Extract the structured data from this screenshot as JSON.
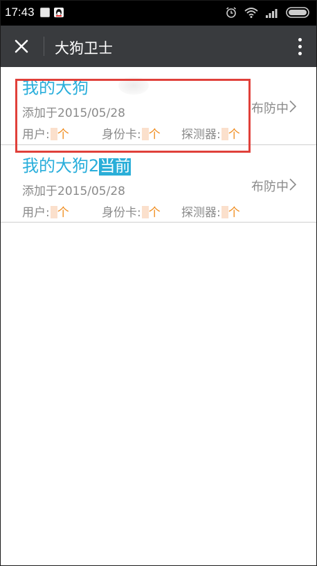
{
  "status_bar": {
    "time": "17:43"
  },
  "app_bar": {
    "title": "大狗卫士"
  },
  "devices": [
    {
      "name": "我的大狗",
      "badge": "",
      "added": "添加于2015/05/28",
      "status": "布防中",
      "stats": {
        "users_label": "用户:",
        "idcards_label": "身份卡:",
        "detectors_label": "探测器:",
        "unit": "个"
      }
    },
    {
      "name": "我的大狗2",
      "badge": "当前",
      "added": "添加于2015/05/28",
      "status": "布防中",
      "stats": {
        "users_label": "用户:",
        "idcards_label": "身份卡:",
        "detectors_label": "探测器:",
        "unit": "个"
      }
    }
  ],
  "colors": {
    "accent": "#29aedb",
    "appbar": "#393b3e",
    "count_unit": "#f08c1e",
    "selection_border": "#e0403a"
  }
}
